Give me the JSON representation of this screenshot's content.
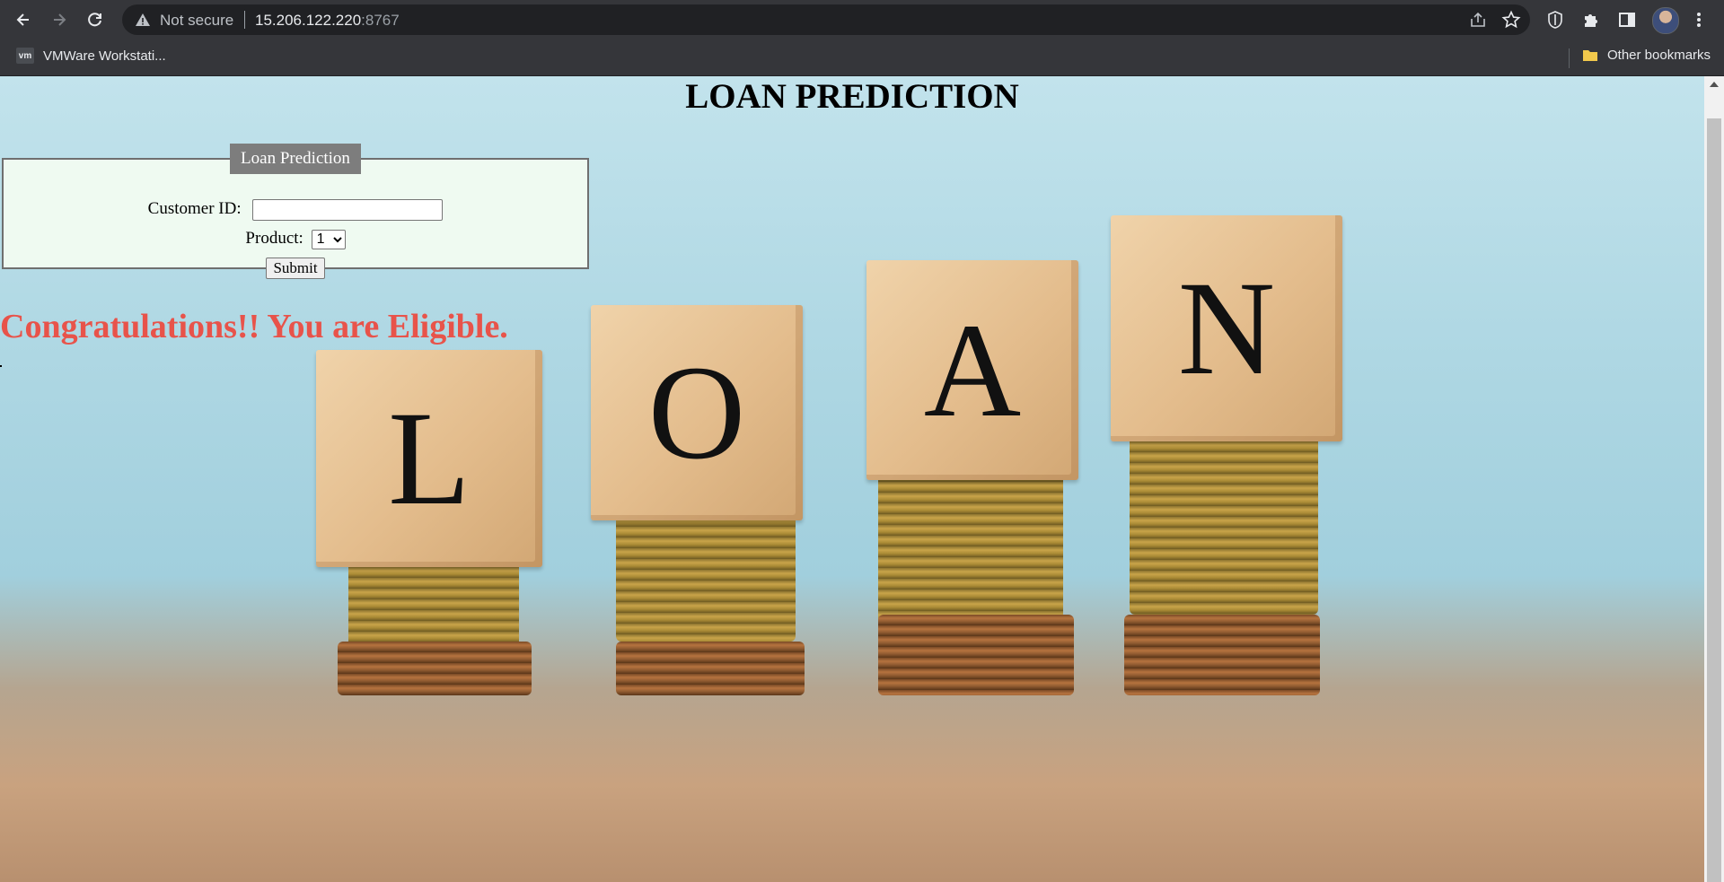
{
  "browser": {
    "security_label": "Not secure",
    "url_host": "15.206.122.220",
    "url_port": ":8767",
    "bookmarks": [
      {
        "icon": "vm",
        "label": "VMWare Workstati..."
      }
    ],
    "other_bookmarks_label": "Other bookmarks"
  },
  "page": {
    "title": "LOAN PREDICTION",
    "form": {
      "legend": "Loan Prediction",
      "customer_id_label": "Customer ID:",
      "customer_id_value": "",
      "product_label": "Product:",
      "product_selected": "1",
      "submit_label": "Submit"
    },
    "result_message": "Congratulations!! You are Eligible.",
    "result_color": "#e8534a",
    "background_letters": [
      "L",
      "O",
      "A",
      "N"
    ]
  }
}
